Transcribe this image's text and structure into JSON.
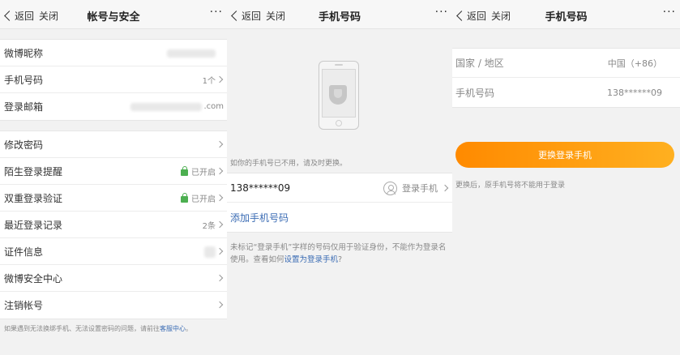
{
  "panel1": {
    "nav": {
      "back": "返回",
      "close": "关闭",
      "title": "帐号与安全",
      "more": "···"
    },
    "group1": [
      {
        "label": "微博昵称"
      },
      {
        "label": "手机号码",
        "value": "1个"
      },
      {
        "label": "登录邮箱",
        "value": ".com"
      }
    ],
    "group2": [
      {
        "label": "修改密码"
      },
      {
        "label": "陌生登录提醒",
        "value": "已开启"
      },
      {
        "label": "双重登录验证",
        "value": "已开启"
      },
      {
        "label": "最近登录记录",
        "value": "2条"
      },
      {
        "label": "证件信息"
      },
      {
        "label": "微博安全中心"
      },
      {
        "label": "注销帐号"
      }
    ],
    "footnote": "如果遇到无法换绑手机、无法设置密码的问题，请前往",
    "footnote_link": "客服中心",
    "footnote_end": "。"
  },
  "panel2": {
    "nav": {
      "back": "返回",
      "close": "关闭",
      "title": "手机号码",
      "more": "···"
    },
    "hint": "如你的手机号已不用，请及时更换。",
    "phone": "138******09",
    "login_tag": "登录手机",
    "add_phone": "添加手机号码",
    "note_part1": "未标记“登录手机”字样的号码仅用于验证身份，不能作为登录名使用。查看如何",
    "note_link": "设置为登录手机",
    "note_end": "?"
  },
  "panel3": {
    "nav": {
      "back": "返回",
      "close": "关闭",
      "title": "手机号码",
      "more": "···"
    },
    "region_label": "国家 / 地区",
    "region_value": "中国（+86）",
    "phone_label": "手机号码",
    "phone_value": "138******09",
    "button": "更换登录手机",
    "tip": "更换后，原手机号将不能用于登录"
  },
  "colors": {
    "accent_orange": "#ff9a10",
    "link_blue": "#3b6cb4",
    "lock_green": "#4caf50"
  }
}
